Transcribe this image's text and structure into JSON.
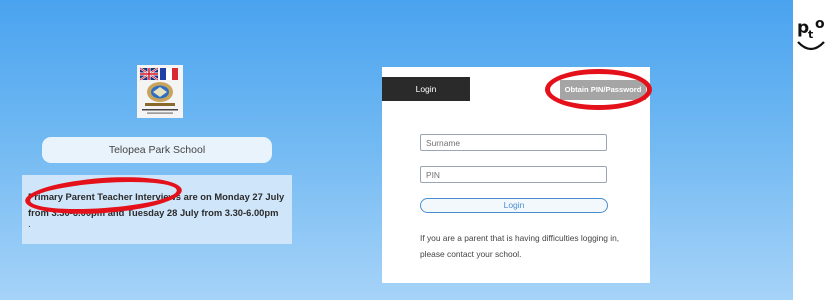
{
  "brand": {
    "logo_icon": "pto-smile-logo",
    "logo_letters": {
      "p": "p",
      "t": "t",
      "o": "o"
    }
  },
  "school": {
    "crest_icon": "school-crest",
    "name": "Telopea Park School"
  },
  "notice": {
    "text": "Primary Parent Teacher Interviews are on Monday 27 July from 3.30-6.00pm and Tuesday 28 July from 3.30-6.00pm",
    "trailing": "."
  },
  "login": {
    "tab_label": "Login",
    "obtain_pin_label": "Obtain PIN/Password",
    "surname_placeholder": "Surname",
    "pin_placeholder": "PIN",
    "submit_label": "Login",
    "help_text": "If you are a parent that is having difficulties logging in, please contact your school."
  },
  "colors": {
    "background_top": "#4aa3ef",
    "background_bottom": "#a6d3f8",
    "highlight_red": "#e4111b",
    "login_tab": "#2a2a2a",
    "obtain_button": "#a5a5a5",
    "login_button_border": "#4a8ed0"
  }
}
